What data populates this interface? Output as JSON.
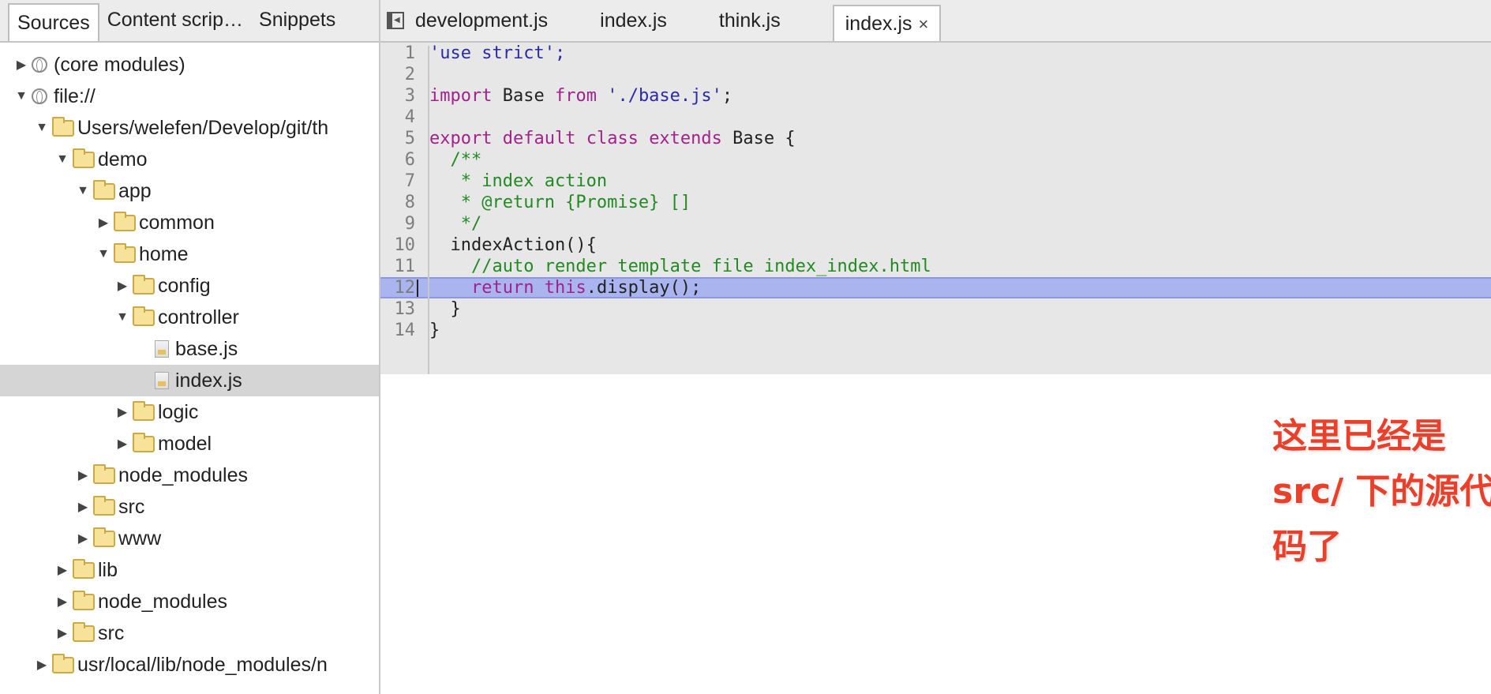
{
  "navigator": {
    "tabs": [
      "Sources",
      "Content scrip…",
      "Snippets"
    ],
    "tree": [
      {
        "label": "(core modules)",
        "icon": "globe",
        "expanded": false
      },
      {
        "label": "file://",
        "icon": "globe",
        "expanded": true
      },
      {
        "label": "Users/welefen/Develop/git/th",
        "icon": "folder",
        "expanded": true
      },
      {
        "label": "demo",
        "icon": "folder",
        "expanded": true
      },
      {
        "label": "app",
        "icon": "folder",
        "expanded": true
      },
      {
        "label": "common",
        "icon": "folder",
        "expanded": false
      },
      {
        "label": "home",
        "icon": "folder",
        "expanded": true
      },
      {
        "label": "config",
        "icon": "folder",
        "expanded": false
      },
      {
        "label": "controller",
        "icon": "folder",
        "expanded": true
      },
      {
        "label": "base.js",
        "icon": "file"
      },
      {
        "label": "index.js",
        "icon": "file",
        "selected": true
      },
      {
        "label": "logic",
        "icon": "folder",
        "expanded": false
      },
      {
        "label": "model",
        "icon": "folder",
        "expanded": false
      },
      {
        "label": "node_modules",
        "icon": "folder",
        "expanded": false
      },
      {
        "label": "src",
        "icon": "folder",
        "expanded": false
      },
      {
        "label": "www",
        "icon": "folder",
        "expanded": false
      },
      {
        "label": "lib",
        "icon": "folder",
        "expanded": false
      },
      {
        "label": "node_modules",
        "icon": "folder",
        "expanded": false
      },
      {
        "label": "src",
        "icon": "folder",
        "expanded": false
      },
      {
        "label": "usr/local/lib/node_modules/n",
        "icon": "folder",
        "expanded": false
      }
    ]
  },
  "editor": {
    "tabs": [
      {
        "label": "development.js"
      },
      {
        "label": "index.js"
      },
      {
        "label": "think.js"
      },
      {
        "label": "index.js",
        "active": true,
        "close": "×"
      }
    ],
    "lines": [
      {
        "n": "1",
        "text": "'use strict';"
      },
      {
        "n": "2",
        "text": ""
      },
      {
        "n": "3",
        "text": "import Base from './base.js';"
      },
      {
        "n": "4",
        "text": ""
      },
      {
        "n": "5",
        "text": "export default class extends Base {"
      },
      {
        "n": "6",
        "text": "  /**"
      },
      {
        "n": "7",
        "text": "   * index action"
      },
      {
        "n": "8",
        "text": "   * @return {Promise} []"
      },
      {
        "n": "9",
        "text": "   */"
      },
      {
        "n": "10",
        "text": "  indexAction(){"
      },
      {
        "n": "11",
        "text": "    //auto render template file index_index.html"
      },
      {
        "n": "12",
        "text": "    return this.display();",
        "highlighted": true
      },
      {
        "n": "13",
        "text": "  }"
      },
      {
        "n": "14",
        "text": "}"
      }
    ]
  },
  "annotation": {
    "lines": [
      "这里已经是",
      "src/ 下的源代",
      "码了"
    ],
    "color": "#e8402a"
  }
}
